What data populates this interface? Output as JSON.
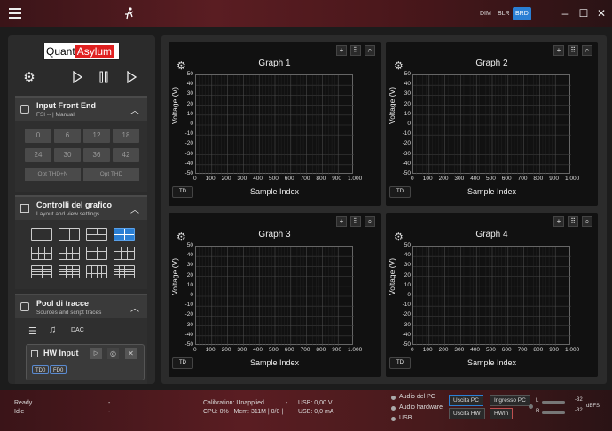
{
  "titlebar": {
    "modes": [
      "DIM",
      "BLR",
      "BRD"
    ],
    "active_mode": "BRD"
  },
  "logo": {
    "part1": "Quant",
    "part2": "Asylum"
  },
  "sections": {
    "input": {
      "title": "Input Front End",
      "subtitle": "FSI -- | Manual",
      "buttons": [
        "0",
        "6",
        "12",
        "18",
        "24",
        "30",
        "36",
        "42"
      ],
      "opt": [
        "Opt THD+N",
        "Opt THD"
      ]
    },
    "controls": {
      "title": "Controlli del grafico",
      "subtitle": "Layout and view settings"
    },
    "pool": {
      "title": "Pool di tracce",
      "subtitle": "Sources and script traces",
      "dac_label": "DAC",
      "hw_title": "HW Input",
      "tags": [
        "TD0",
        "FD0"
      ]
    }
  },
  "graphs": [
    {
      "title": "Graph 1",
      "ylabel": "Voltage (V)",
      "xlabel": "Sample Index",
      "td": "TD"
    },
    {
      "title": "Graph 2",
      "ylabel": "Voltage (V)",
      "xlabel": "Sample Index",
      "td": "TD"
    },
    {
      "title": "Graph 3",
      "ylabel": "Voltage (V)",
      "xlabel": "Sample Index",
      "td": "TD"
    },
    {
      "title": "Graph 4",
      "ylabel": "Voltage (V)",
      "xlabel": "Sample Index",
      "td": "TD"
    }
  ],
  "axes": {
    "yticks": [
      "50",
      "40",
      "30",
      "20",
      "10",
      "0",
      "-10",
      "-20",
      "-30",
      "-40",
      "-50"
    ],
    "xticks": [
      "0",
      "100",
      "200",
      "300",
      "400",
      "500",
      "600",
      "700",
      "800",
      "900",
      "1.000"
    ]
  },
  "status": {
    "line1": "Ready",
    "line2": "Idle",
    "dash1": "-",
    "dash2": "-",
    "calibration": "Calibration: Unapplied",
    "perf": "CPU: 0% | Mem: 311M | 0/0 |",
    "dash3": "-",
    "usb_v": "USB: 0,00 V",
    "usb_a": "USB: 0,0 mA",
    "audio_pc": "Audio del PC",
    "audio_hw": "Audio hardware",
    "usb": "USB",
    "btn_uscita_pc": "Uscita PC",
    "btn_ingresso_pc": "Ingresso PC",
    "btn_uscita_hw": "Uscita HW",
    "btn_hwin": "HWIn",
    "meter_l": "L",
    "meter_r": "R",
    "val_l": "-32",
    "val_r": "-32",
    "unit": "dBFS"
  },
  "colors": {
    "accent": "#2a7fd4",
    "brand_red": "#e02020"
  }
}
